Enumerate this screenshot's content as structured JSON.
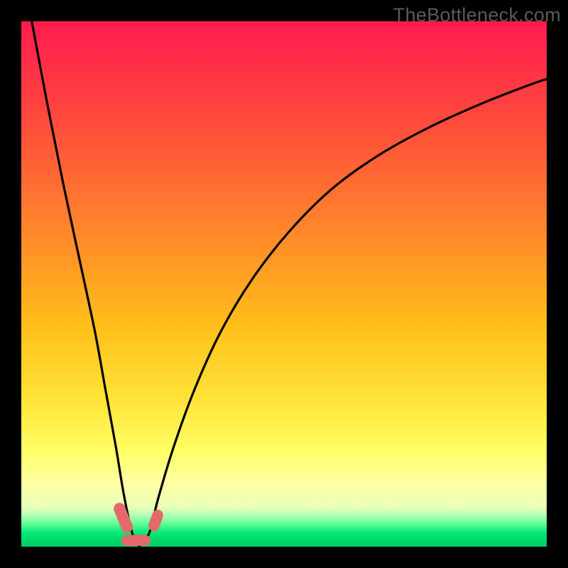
{
  "watermark": "TheBottleneck.com",
  "colors": {
    "frame": "#000000",
    "curve": "#000000",
    "marker_fill": "#e46a6a",
    "gradient_top": "#ff1a4d",
    "gradient_bottom": "#00cc66"
  },
  "chart_data": {
    "type": "line",
    "title": "",
    "xlabel": "",
    "ylabel": "",
    "xlim": [
      0,
      100
    ],
    "ylim": [
      0,
      100
    ],
    "grid": false,
    "legend": false,
    "description": "V-shaped bottleneck curve on a vertical red→yellow→green gradient; minimum (optimal match) sits around x≈22 at y≈0. Left branch rises steeply to top-left corner; right branch rises with decreasing slope toward upper-right.",
    "series": [
      {
        "name": "bottleneck-curve",
        "x": [
          2,
          5,
          8,
          11,
          14,
          16,
          18,
          19.5,
          21,
          22,
          23,
          24.5,
          26,
          29,
          33,
          38,
          44,
          51,
          59,
          68,
          78,
          88,
          97,
          100
        ],
        "y": [
          100,
          84,
          69,
          55,
          41,
          30,
          19,
          10,
          3,
          0.5,
          0.5,
          3,
          9,
          19,
          30,
          41,
          51,
          60,
          68,
          74.5,
          80,
          84.5,
          88,
          89
        ]
      }
    ],
    "markers": [
      {
        "shape": "rounded-pill",
        "x": 19.4,
        "y": 5.5,
        "w": 2.2,
        "h": 6.0,
        "angle": -22
      },
      {
        "shape": "rounded-pill",
        "x": 21.8,
        "y": 1.2,
        "w": 5.5,
        "h": 2.1,
        "angle": 0
      },
      {
        "shape": "rounded-pill",
        "x": 25.6,
        "y": 5.0,
        "w": 2.1,
        "h": 4.2,
        "angle": 20
      }
    ]
  }
}
